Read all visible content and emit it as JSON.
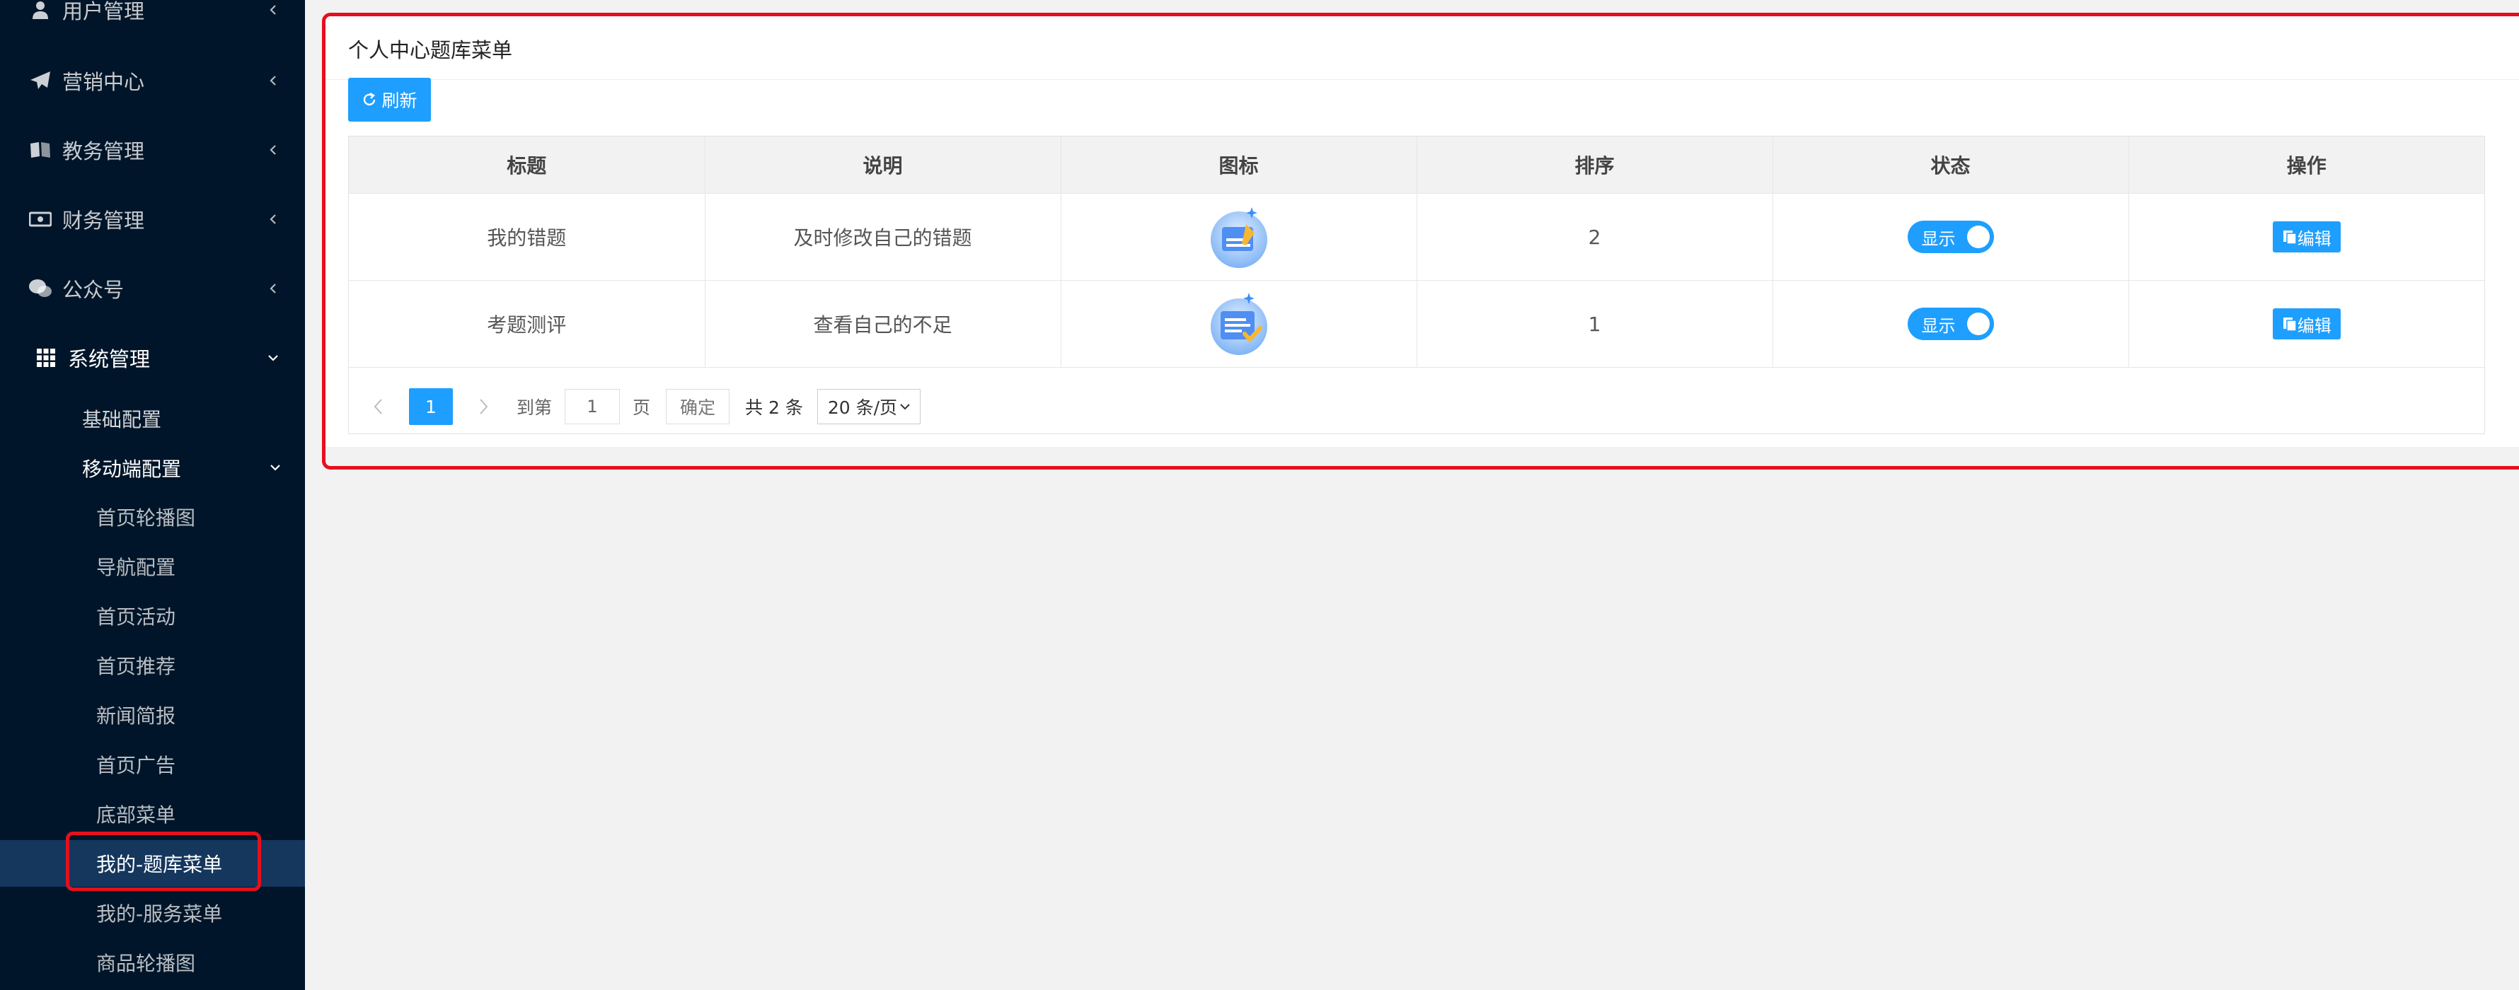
{
  "sidebar": {
    "menu": [
      {
        "label": "用户管理",
        "icon": "user-icon"
      },
      {
        "label": "营销中心",
        "icon": "paper-plane-icon"
      },
      {
        "label": "教务管理",
        "icon": "book-icon"
      },
      {
        "label": "财务管理",
        "icon": "money-icon"
      },
      {
        "label": "公众号",
        "icon": "wechat-icon"
      },
      {
        "label": "系统管理",
        "icon": "grid-icon"
      }
    ],
    "system_sub": [
      "基础配置",
      "移动端配置"
    ],
    "mobile_items": [
      "首页轮播图",
      "导航配置",
      "首页活动",
      "首页推荐",
      "新闻简报",
      "首页广告",
      "底部菜单",
      "我的-题库菜单",
      "我的-服务菜单",
      "商品轮播图"
    ]
  },
  "main": {
    "title": "个人中心题库菜单",
    "refresh_label": "刷新",
    "table": {
      "headers": [
        "标题",
        "说明",
        "图标",
        "排序",
        "状态",
        "操作"
      ],
      "rows": [
        {
          "title": "我的错题",
          "desc": "及时修改自己的错题",
          "icon": "wrong-questions-icon",
          "sort": "2",
          "status": "显示",
          "action": "编辑"
        },
        {
          "title": "考题测评",
          "desc": "查看自己的不足",
          "icon": "exam-evaluation-icon",
          "sort": "1",
          "status": "显示",
          "action": "编辑"
        }
      ]
    },
    "pager": {
      "current": "1",
      "goto_label": "到第",
      "page_input": "1",
      "page_label": "页",
      "confirm_label": "确定",
      "total": "共 2 条",
      "page_size": "20 条/页"
    }
  },
  "colors": {
    "sidebar_bg": "#001529",
    "active_bg": "#15375e",
    "primary": "#1e9fff",
    "highlight": "#e5101d"
  }
}
